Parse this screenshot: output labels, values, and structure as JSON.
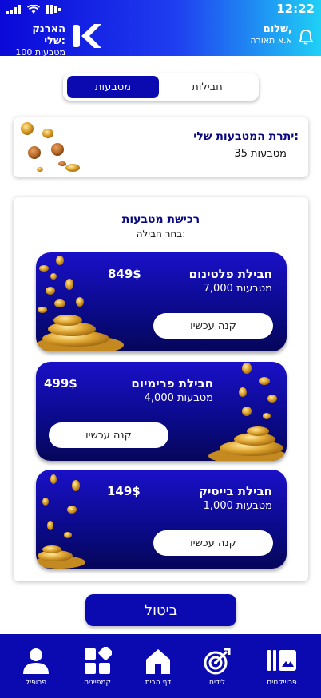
{
  "status_bar": {
    "time": "12:22"
  },
  "header": {
    "wallet_title": "הארנק שלי:",
    "wallet_value": "100 מטבעות",
    "greeting": "שלום,",
    "user_name": "א.א תאורה"
  },
  "tabs": [
    {
      "label": "מטבעות",
      "active": true
    },
    {
      "label": "חבילות",
      "active": false
    }
  ],
  "balance": {
    "title": "יתרת המטבעות שלי:",
    "value": "35 מטבעות"
  },
  "purchase": {
    "title": "רכישת מטבעות",
    "subtitle": "בחר חבילה:"
  },
  "packages": [
    {
      "name": "חבילת פלטינום",
      "coins": "7,000 מטבעות",
      "price": "849$",
      "button": "קנה עכשיו"
    },
    {
      "name": "חבילת פרימיום",
      "coins": "4,000 מטבעות",
      "price": "499$",
      "button": "קנה עכשיו"
    },
    {
      "name": "חבילת בייסיק",
      "coins": "1,000 מטבעות",
      "price": "149$",
      "button": "קנה עכשיו"
    }
  ],
  "cancel_label": "ביטול",
  "nav": [
    {
      "label": "פרופיל",
      "icon": "profile-icon"
    },
    {
      "label": "קמפיינים",
      "icon": "campaigns-icon"
    },
    {
      "label": "דף הבית",
      "icon": "home-icon"
    },
    {
      "label": "לידים",
      "icon": "leads-icon"
    },
    {
      "label": "פרוייקטים",
      "icon": "projects-icon"
    }
  ],
  "colors": {
    "primary": "#0a0ab0",
    "header_gradient_end": "#1fd0f5",
    "gold": "#d9a12b"
  }
}
